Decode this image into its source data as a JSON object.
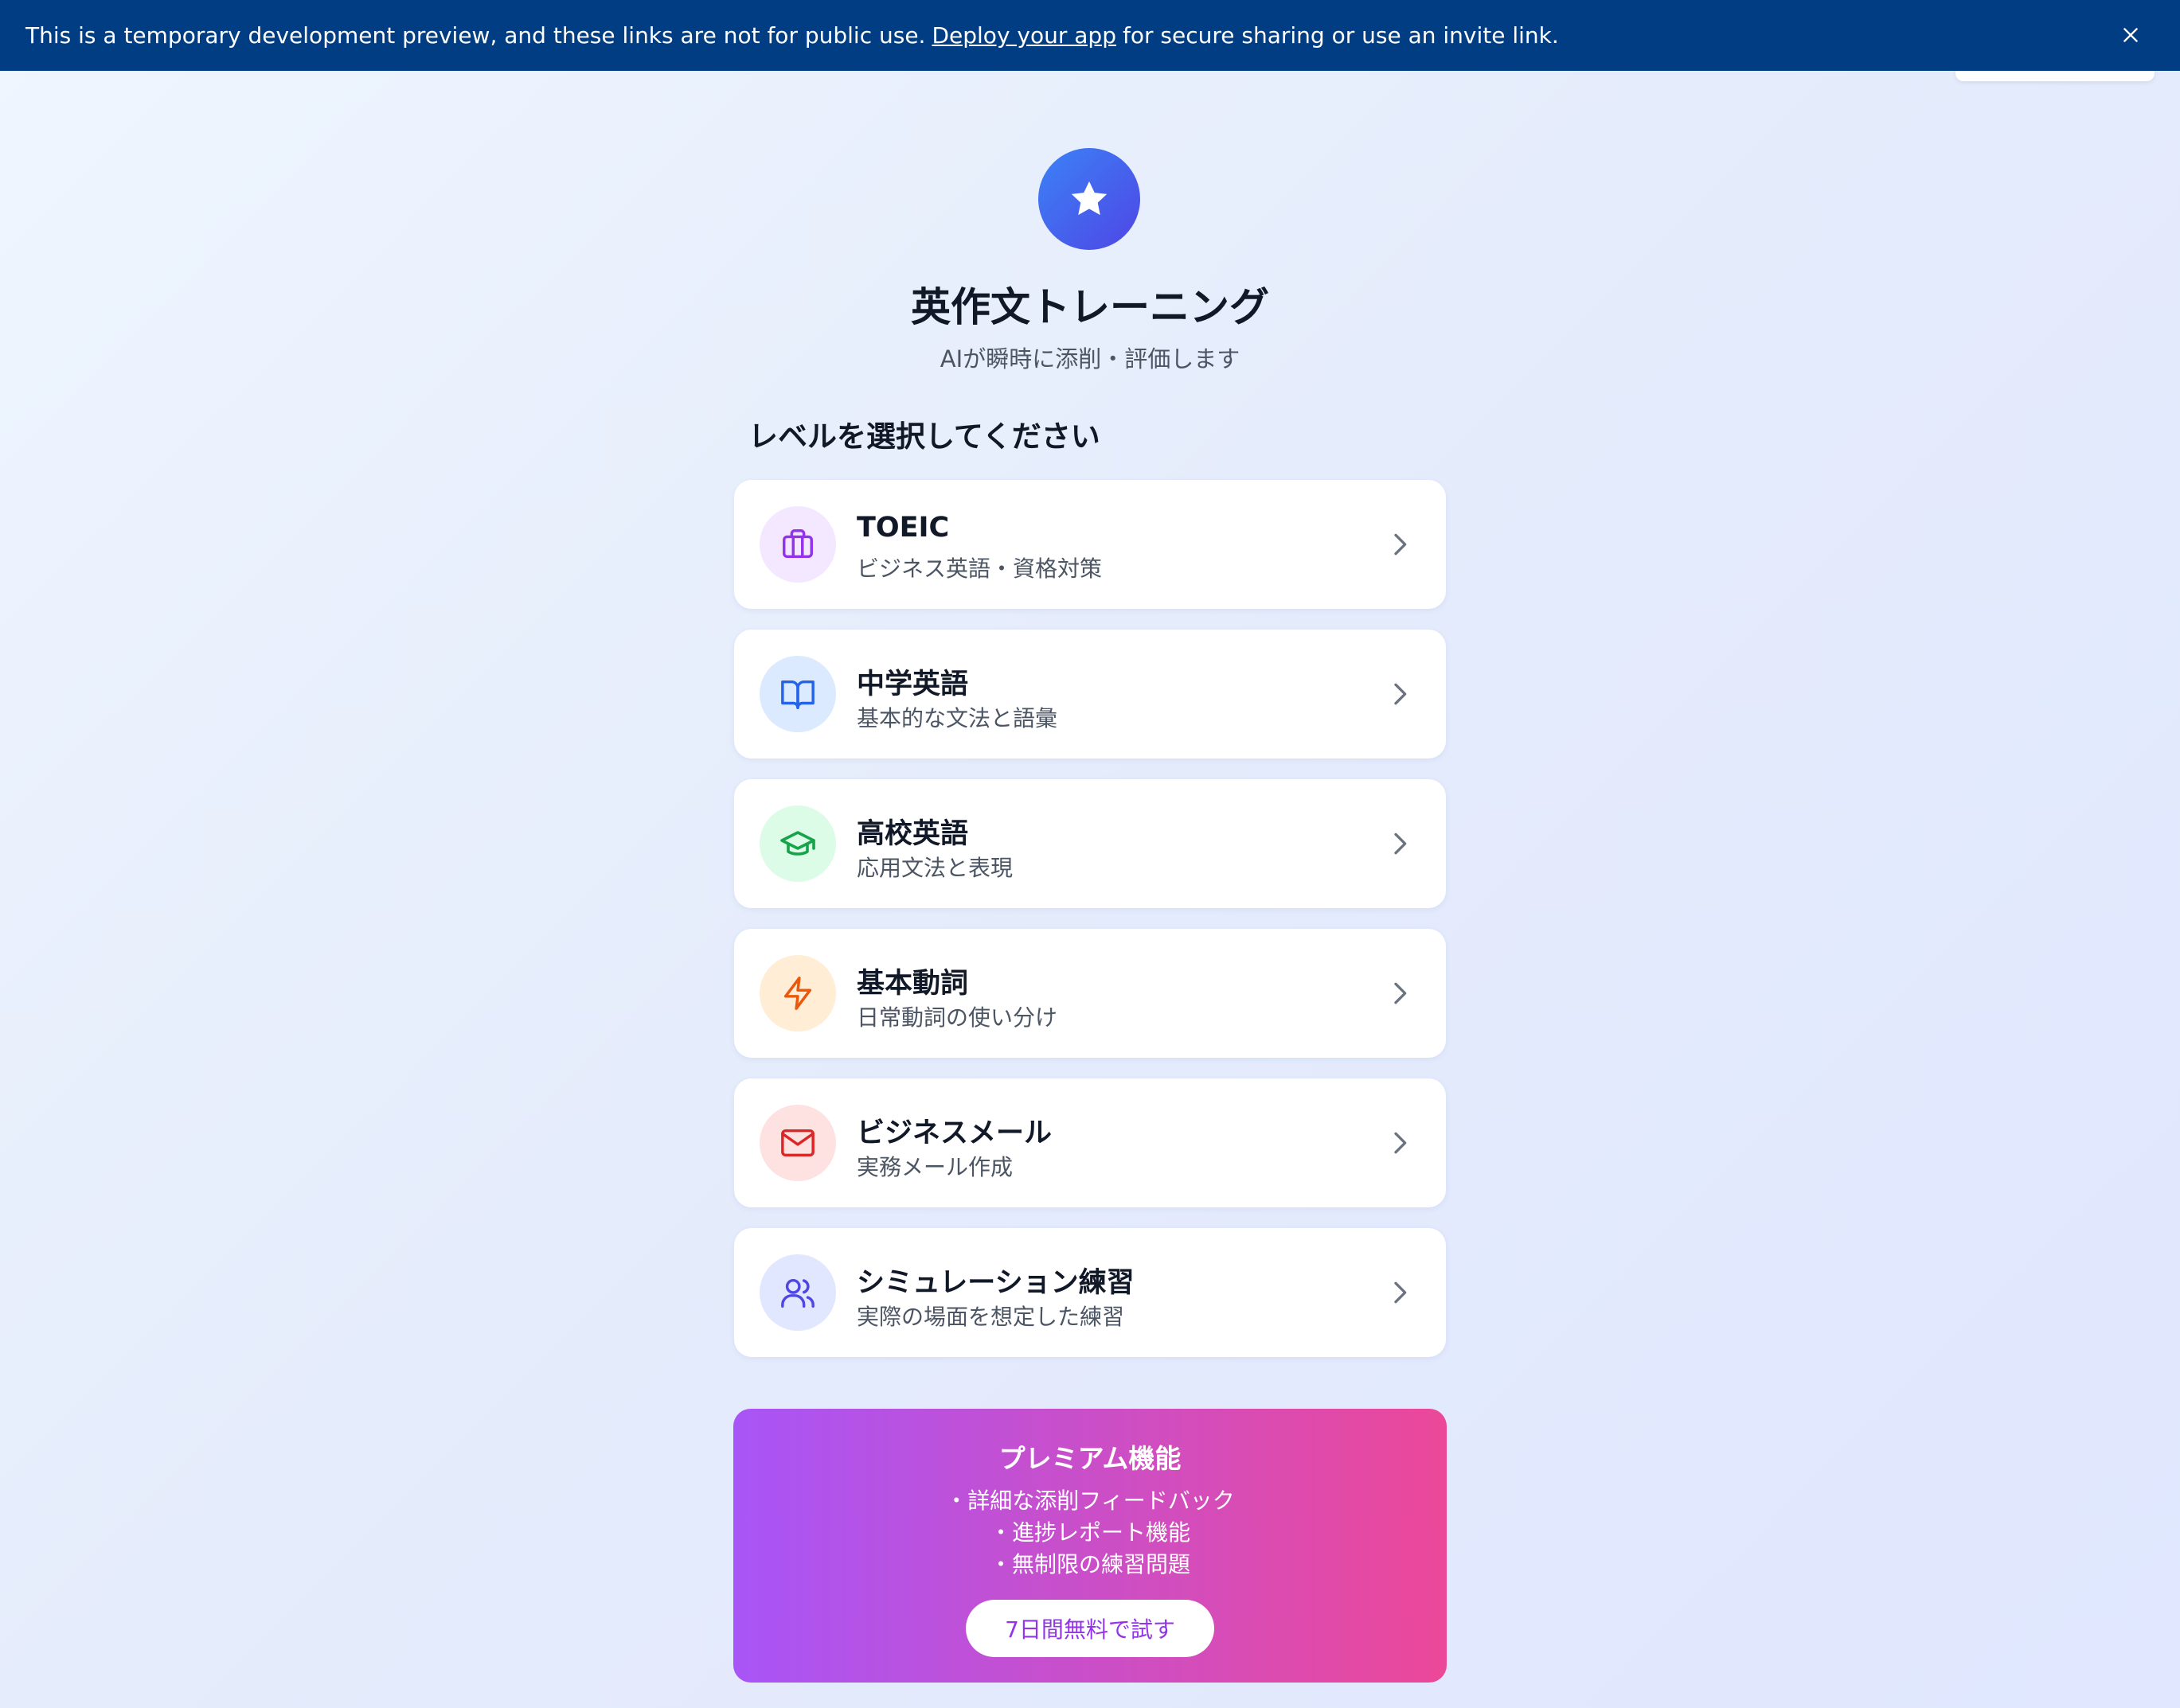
{
  "banner": {
    "text_before": "This is a temporary development preview, and these links are not for public use.",
    "link_text": "Deploy your app",
    "text_after": "for secure sharing or use an invite link.",
    "close_icon": "close-icon"
  },
  "header": {
    "logo_icon": "star-icon",
    "title": "英作文トレーニング",
    "subtitle": "AIが瞬時に添削・評価します"
  },
  "section_heading": "レベルを選択してください",
  "levels": [
    {
      "title": "TOEIC",
      "description": "ビジネス英語・資格対策",
      "icon": "briefcase-icon",
      "icon_color": "#9333ea",
      "icon_bg": "#f3e8ff"
    },
    {
      "title": "中学英語",
      "description": "基本的な文法と語彙",
      "icon": "book-open-icon",
      "icon_color": "#2563eb",
      "icon_bg": "#dbeafe"
    },
    {
      "title": "高校英語",
      "description": "応用文法と表現",
      "icon": "graduation-cap-icon",
      "icon_color": "#16a34a",
      "icon_bg": "#dcfce7"
    },
    {
      "title": "基本動詞",
      "description": "日常動詞の使い分け",
      "icon": "zap-icon",
      "icon_color": "#ea580c",
      "icon_bg": "#ffedd5"
    },
    {
      "title": "ビジネスメール",
      "description": "実務メール作成",
      "icon": "mail-icon",
      "icon_color": "#dc2626",
      "icon_bg": "#fee2e2"
    },
    {
      "title": "シミュレーション練習",
      "description": "実際の場面を想定した練習",
      "icon": "users-icon",
      "icon_color": "#4f46e5",
      "icon_bg": "#e0e7ff"
    }
  ],
  "premium": {
    "title": "プレミアム機能",
    "features": [
      "詳細な添削フィードバック",
      "進捗レポート機能",
      "無制限の練習問題"
    ],
    "cta_label": "7日間無料で試す",
    "gradient_start": "#a855f7",
    "gradient_end": "#ec4899"
  }
}
